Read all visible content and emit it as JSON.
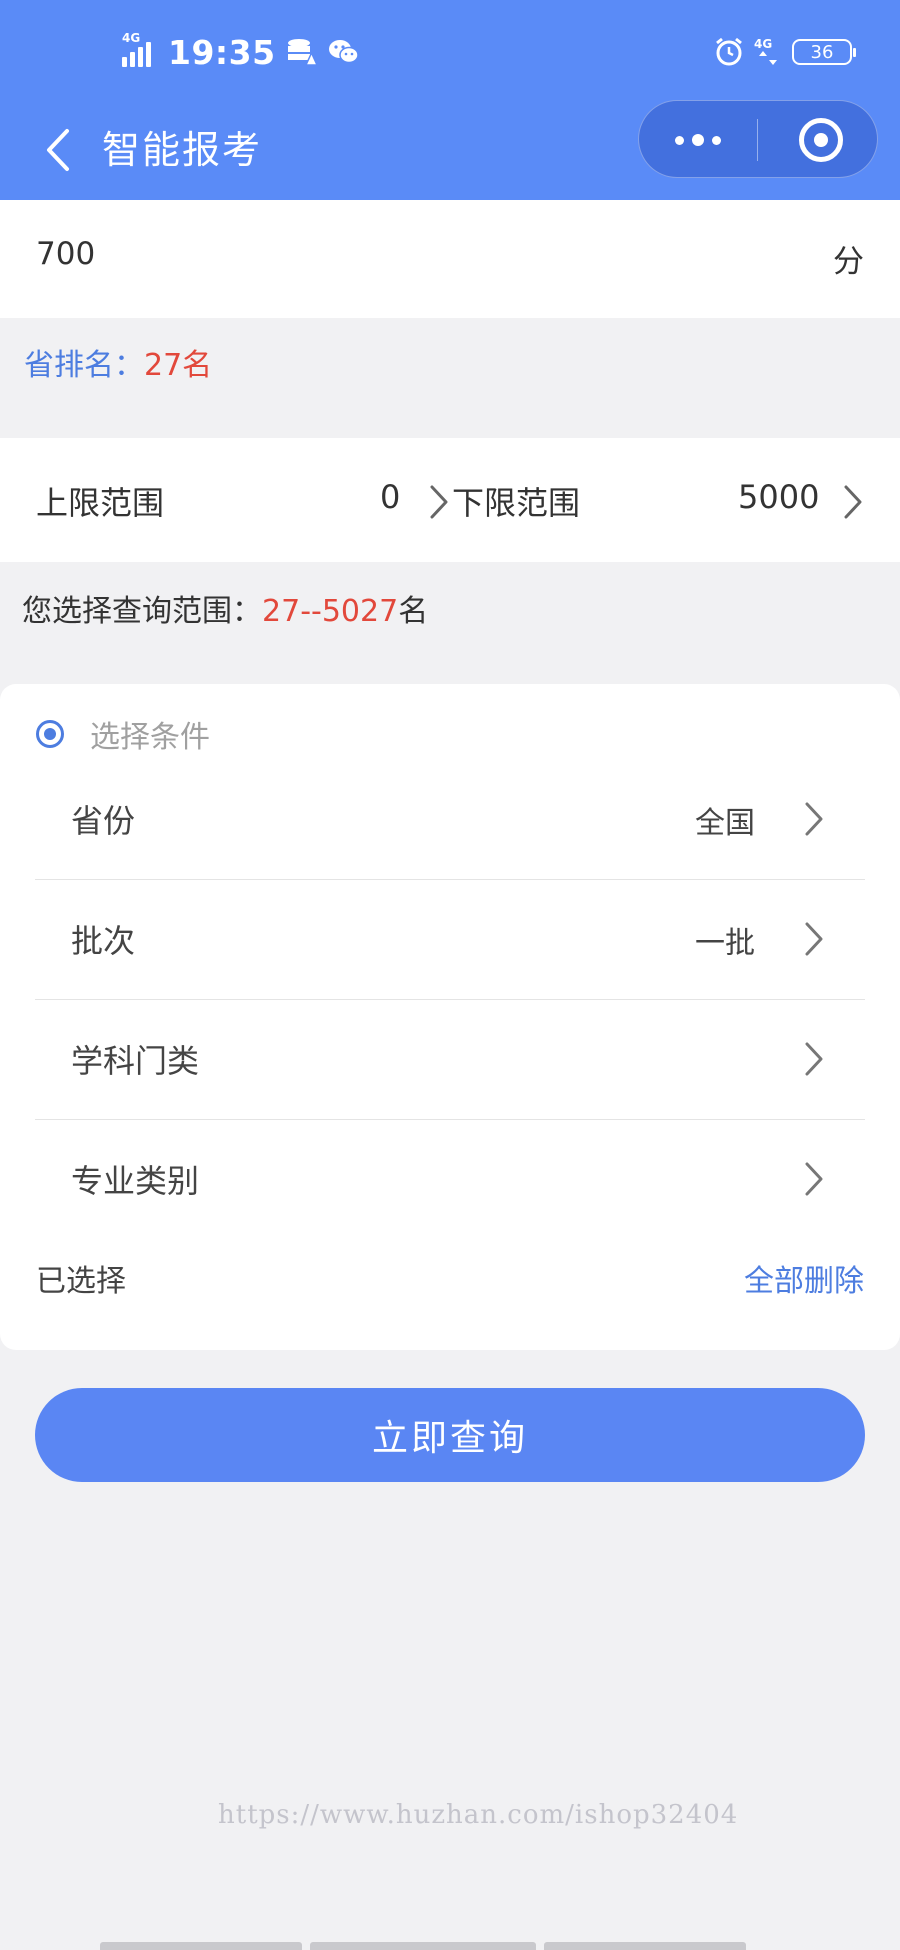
{
  "status_bar": {
    "time": "19:35",
    "signal_label": "4G",
    "net_label": "4G",
    "battery": "36"
  },
  "nav": {
    "title": "智能报考"
  },
  "score": {
    "value": "700",
    "unit": "分"
  },
  "rank": {
    "label": "省排名：",
    "value": "27名"
  },
  "range": {
    "upper_label": "上限范围",
    "upper_value": "0",
    "lower_label": "下限范围",
    "lower_value": "5000"
  },
  "chosen_range": {
    "prefix": "您选择查询范围：",
    "start": "27",
    "separator": "--",
    "end": "5027",
    "suffix": "名"
  },
  "conditions": {
    "title": "选择条件",
    "rows": [
      {
        "label": "省份",
        "value": "全国"
      },
      {
        "label": "批次",
        "value": "一批"
      },
      {
        "label": "学科门类",
        "value": ""
      },
      {
        "label": "专业类别",
        "value": ""
      }
    ],
    "selected_label": "已选择",
    "delete_all": "全部删除"
  },
  "query_button": "立即查询",
  "watermark": "https://www.huzhan.com/ishop32404",
  "colors": {
    "header": "#5a8bf7",
    "accent": "#4d7de0",
    "highlight": "#e2483b",
    "button": "#5a86f3",
    "background": "#f1f1f3"
  }
}
